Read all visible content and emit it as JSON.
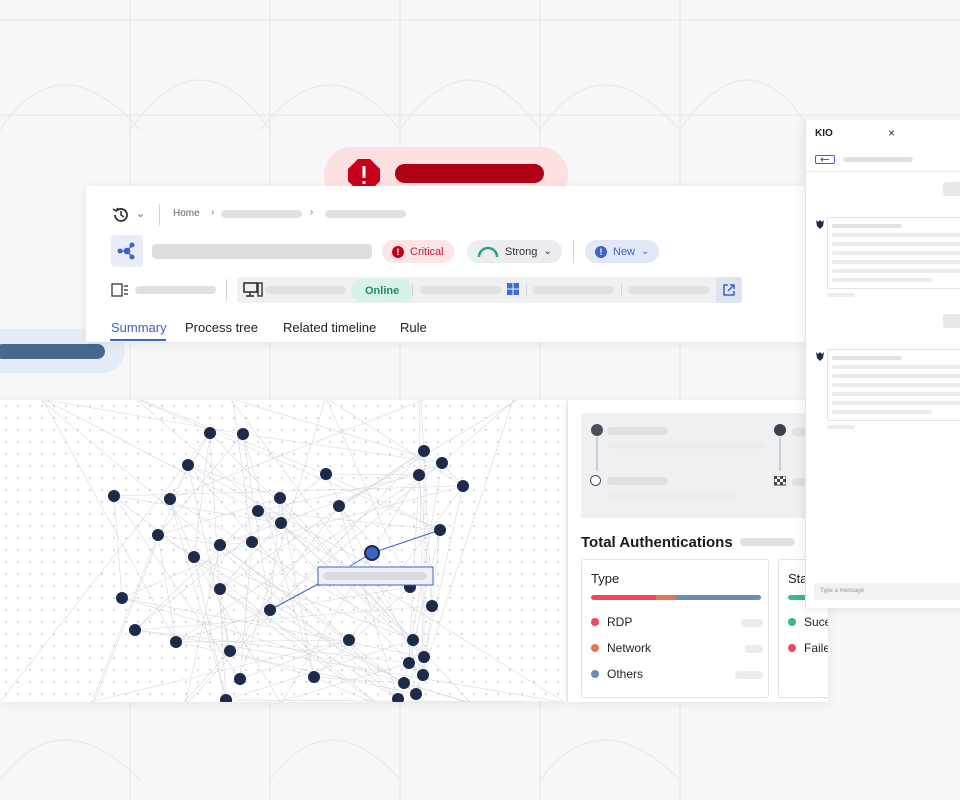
{
  "alert": {
    "icon": "alert-octagon-icon"
  },
  "header": {
    "history_icon": "history-icon",
    "breadcrumb": {
      "home": "Home"
    },
    "badges": {
      "severity": "Critical",
      "confidence": "Strong",
      "status": "New"
    },
    "online_label": "Online"
  },
  "tabs": [
    {
      "label": "Summary"
    },
    {
      "label": "Process tree"
    },
    {
      "label": "Related timeline"
    },
    {
      "label": "Rule"
    }
  ],
  "auth": {
    "title": "Total Authentications",
    "type_card": {
      "heading": "Type",
      "items": [
        {
          "label": "RDP",
          "color": "#f0475a",
          "share": 0.38
        },
        {
          "label": "Network",
          "color": "#e07654",
          "share": 0.12
        },
        {
          "label": "Others",
          "color": "#6a8db5",
          "share": 0.5
        }
      ]
    },
    "status_card": {
      "heading": "Sta",
      "items": [
        {
          "label": "Sucess",
          "color": "#3cb88a"
        },
        {
          "label": "Failed",
          "color": "#f0475a"
        }
      ]
    }
  },
  "chat": {
    "title": "KIO",
    "close": "×",
    "input_placeholder": "Type a message"
  },
  "colors": {
    "critical_red": "#b00016",
    "accent_blue": "#3d62c9",
    "node": "#1d2a4a"
  }
}
